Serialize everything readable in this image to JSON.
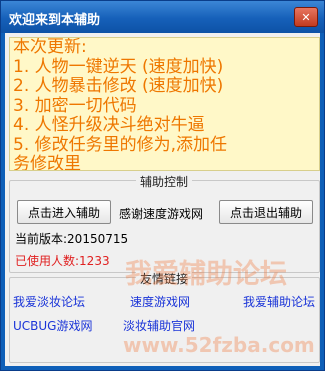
{
  "window": {
    "title": "欢迎来到本辅助",
    "close_symbol": "✕"
  },
  "notes": {
    "lines": [
      "本次更新:",
      "1. 人物一键逆天 (速度加快)",
      "2. 人物暴击修改 (速度加快)",
      "3. 加密一切代码",
      "4. 人怪升级决斗绝对牛逼",
      "5. 修改任务里的修为,添加任",
      "务修改里"
    ]
  },
  "control": {
    "group_label": "辅助控制",
    "enter_button": "点击进入辅助",
    "thanks_text": "感谢速度游戏网",
    "exit_button": "点击退出辅助",
    "version": "当前版本:20150715",
    "users": "已使用人数:1233"
  },
  "links": {
    "group_label": "友情链接",
    "items": [
      "我爱淡妆论坛",
      "速度游戏网",
      "我爱辅助论坛",
      "UCBUG游戏网",
      "淡妆辅助官网"
    ]
  },
  "watermark": {
    "title": "我爱辅助论坛",
    "url": "www.52fzba.com"
  },
  "colors": {
    "title_bar": "#1660b9",
    "notes_bg": "#fff8c8",
    "notes_text": "#ee7700",
    "users_text": "#e02020",
    "link": "#1a34d8"
  }
}
